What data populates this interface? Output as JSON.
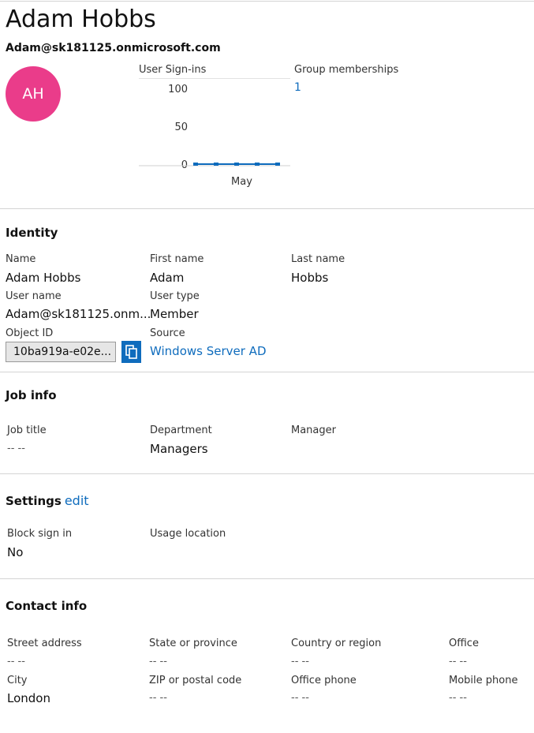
{
  "header": {
    "display_name": "Adam Hobbs",
    "email": "Adam@sk181125.onmicrosoft.com",
    "avatar_initials": "AH",
    "avatar_color": "#ea3c8a"
  },
  "tiles": {
    "signins_label": "User Sign-ins",
    "groups_label": "Group memberships",
    "groups_count": "1"
  },
  "chart_data": {
    "type": "line",
    "title": "User Sign-ins",
    "x": [
      "",
      "",
      "",
      "",
      ""
    ],
    "xtick_labels": [
      "May"
    ],
    "series": [
      {
        "values": [
          0,
          0,
          0,
          0,
          0
        ]
      }
    ],
    "yticks": [
      "100",
      "50",
      "0"
    ],
    "ylim": [
      0,
      100
    ],
    "grid": false,
    "color": "#0f6cbd"
  },
  "identity": {
    "heading": "Identity",
    "name_label": "Name",
    "name_value": "Adam Hobbs",
    "first_name_label": "First name",
    "first_name_value": "Adam",
    "last_name_label": "Last name",
    "last_name_value": "Hobbs",
    "user_name_label": "User name",
    "user_name_value": "Adam@sk181125.onm...",
    "user_type_label": "User type",
    "user_type_value": "Member",
    "object_id_label": "Object ID",
    "object_id_value": "10ba919a-e02e...",
    "source_label": "Source",
    "source_value": "Windows Server AD",
    "copy_icon": "copy-icon"
  },
  "job_info": {
    "heading": "Job info",
    "job_title_label": "Job title",
    "job_title_value": "-- --",
    "department_label": "Department",
    "department_value": "Managers",
    "manager_label": "Manager"
  },
  "settings": {
    "heading": "Settings",
    "edit_label": "edit",
    "block_label": "Block sign in",
    "block_value": "No",
    "usage_label": "Usage location"
  },
  "contact": {
    "heading": "Contact info",
    "street_label": "Street address",
    "street_value": "-- --",
    "state_label": "State or province",
    "state_value": "-- --",
    "country_label": "Country or region",
    "country_value": "-- --",
    "office_label": "Office",
    "office_value": "-- --",
    "city_label": "City",
    "city_value": "London",
    "zip_label": "ZIP or postal code",
    "zip_value": "-- --",
    "office_phone_label": "Office phone",
    "office_phone_value": "-- --",
    "mobile_label": "Mobile phone",
    "mobile_value": "-- --"
  }
}
